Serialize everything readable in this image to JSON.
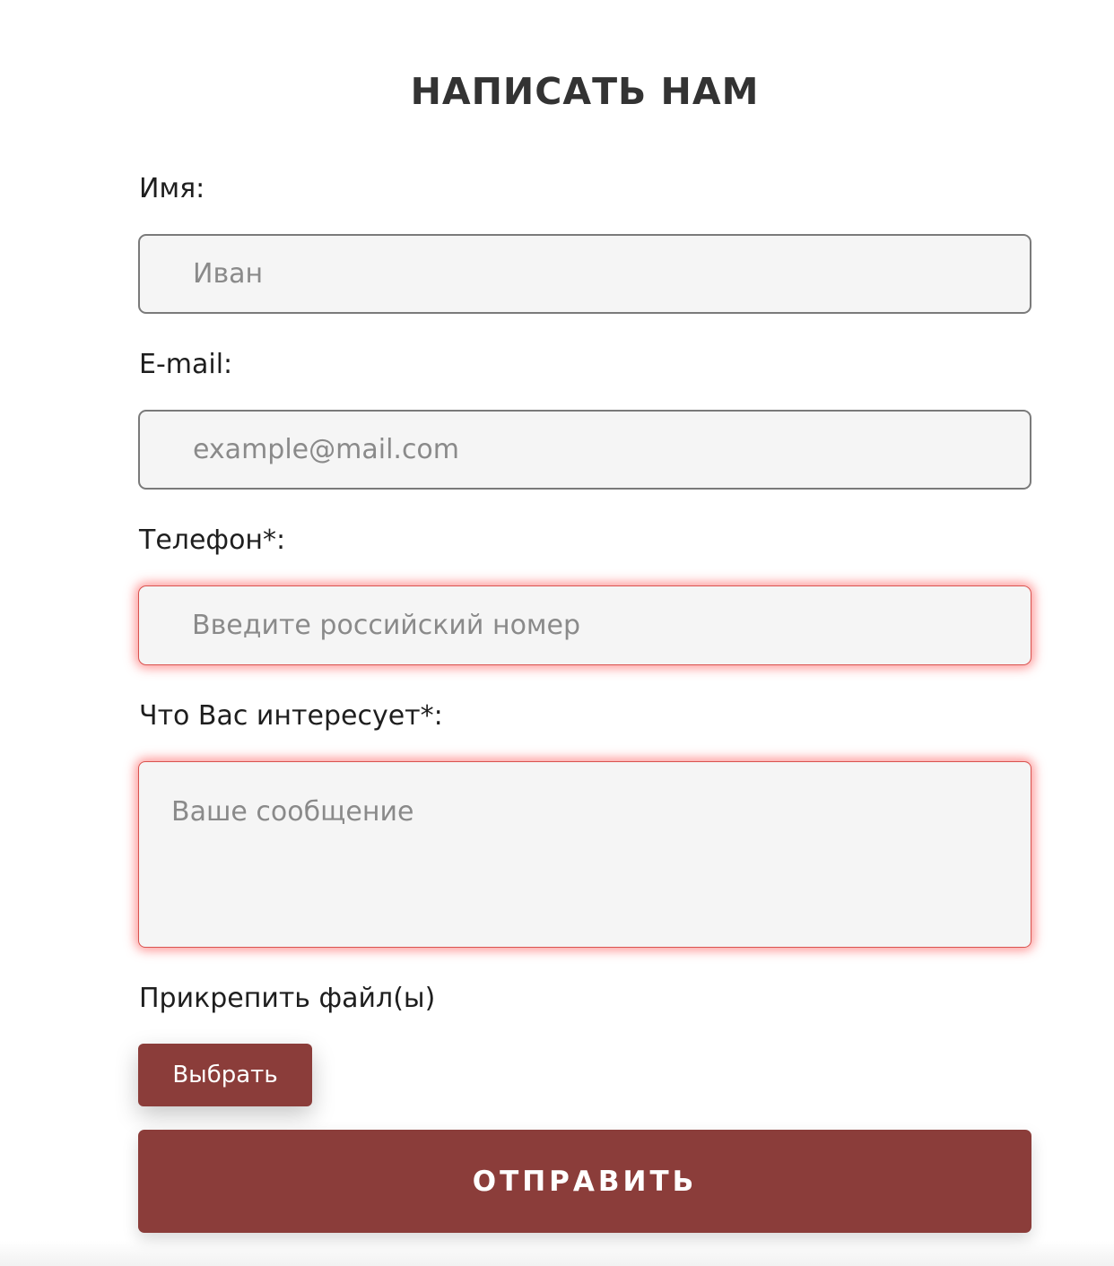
{
  "form": {
    "title": "НАПИСАТЬ НАМ",
    "name": {
      "label": "Имя:",
      "placeholder": "Иван",
      "value": ""
    },
    "email": {
      "label": "E-mail:",
      "placeholder": "example@mail.com",
      "value": ""
    },
    "phone": {
      "label": "Телефон*:",
      "placeholder": "Введите российский номер",
      "value": "",
      "state": "error"
    },
    "message": {
      "label": "Что Вас интересует*:",
      "placeholder": "Ваше сообщение",
      "value": "",
      "state": "error"
    },
    "attach": {
      "label": "Прикрепить файл(ы)",
      "button_label": "Выбрать"
    },
    "submit_label": "ОТПРАВИТЬ"
  },
  "colors": {
    "accent": "#8b3d3a",
    "field_background": "#f5f5f5",
    "error_glow": "#ff3c3c",
    "title": "#333333"
  }
}
